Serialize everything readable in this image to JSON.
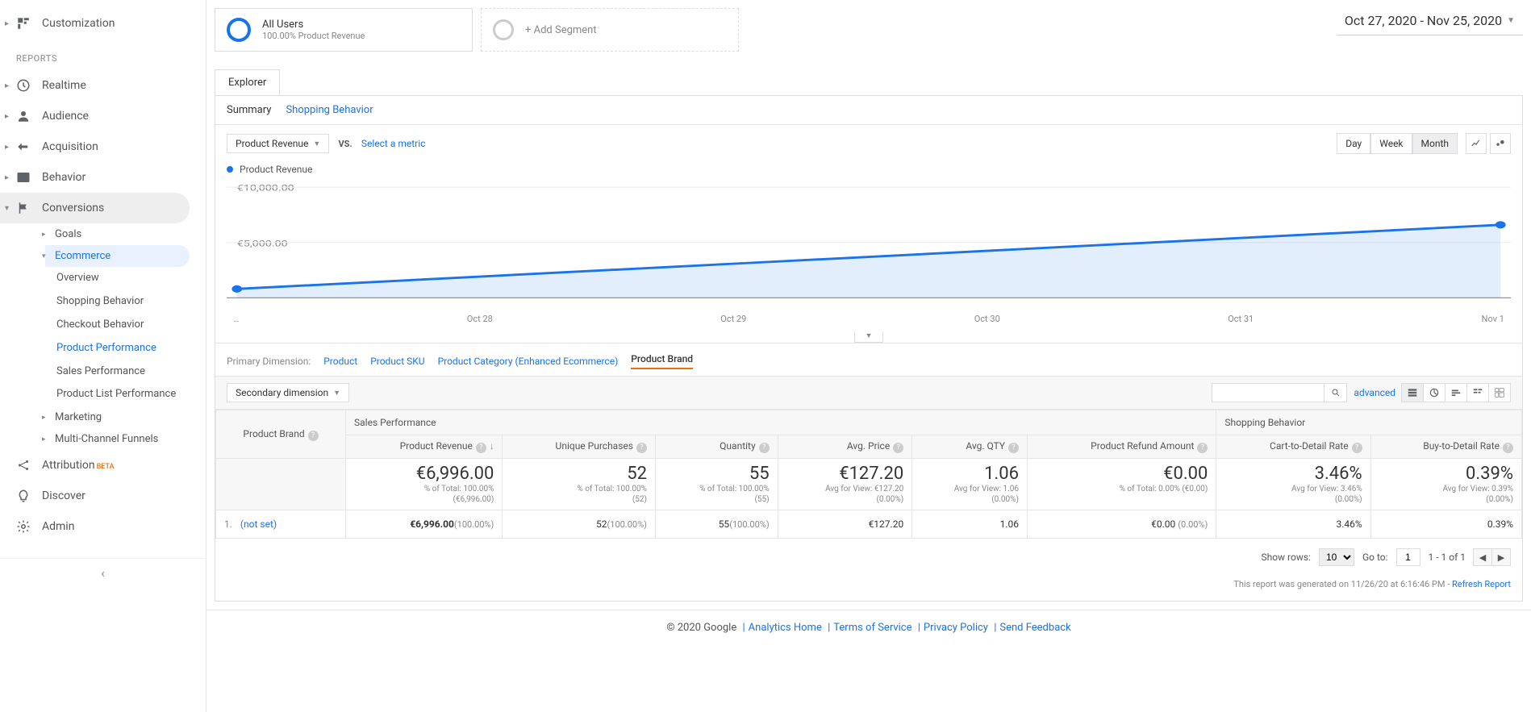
{
  "sidebar": {
    "customization": "Customization",
    "reports_header": "REPORTS",
    "realtime": "Realtime",
    "audience": "Audience",
    "acquisition": "Acquisition",
    "behavior": "Behavior",
    "conversions": "Conversions",
    "goals": "Goals",
    "ecommerce": "Ecommerce",
    "eco_items": {
      "overview": "Overview",
      "shopping": "Shopping Behavior",
      "checkout": "Checkout Behavior",
      "product": "Product Performance",
      "sales": "Sales Performance",
      "plist": "Product List Performance"
    },
    "marketing": "Marketing",
    "multi": "Multi-Channel Funnels",
    "attribution": "Attribution",
    "beta": "BETA",
    "discover": "Discover",
    "admin": "Admin"
  },
  "segments": {
    "all_users": "All Users",
    "all_users_sub": "100.00% Product Revenue",
    "add": "+ Add Segment"
  },
  "daterange": "Oct 27, 2020 - Nov 25, 2020",
  "tabs": {
    "explorer": "Explorer",
    "summary": "Summary",
    "shopping": "Shopping Behavior"
  },
  "metric_selector": "Product Revenue",
  "vs": "VS.",
  "select_metric": "Select a metric",
  "time": {
    "day": "Day",
    "week": "Week",
    "month": "Month"
  },
  "legend": "Product Revenue",
  "chart_data": {
    "type": "line",
    "x": [
      "…",
      "Oct 28",
      "Oct 29",
      "Oct 30",
      "Oct 31",
      "Nov 1"
    ],
    "values": [
      800,
      1960,
      3120,
      4280,
      5440,
      6600
    ],
    "yticks": [
      "€10,000.00",
      "€5,000.00"
    ],
    "ylim": [
      0,
      10000
    ]
  },
  "primary_dim": {
    "label": "Primary Dimension:",
    "product": "Product",
    "sku": "Product SKU",
    "category": "Product Category (Enhanced Ecommerce)",
    "brand": "Product Brand"
  },
  "secondary_dim": "Secondary dimension",
  "advanced": "advanced",
  "table": {
    "group_sales": "Sales Performance",
    "group_shopping": "Shopping Behavior",
    "col_brand": "Product Brand",
    "cols": {
      "rev": "Product Revenue",
      "uniq": "Unique Purchases",
      "qty": "Quantity",
      "avgp": "Avg. Price",
      "avgq": "Avg. QTY",
      "refund": "Product Refund Amount",
      "cart": "Cart-to-Detail Rate",
      "buy": "Buy-to-Detail Rate"
    },
    "totals": {
      "rev": "€6,996.00",
      "rev_sub1": "% of Total: 100.00%",
      "rev_sub2": "(€6,996.00)",
      "uniq": "52",
      "uniq_sub1": "% of Total: 100.00%",
      "uniq_sub2": "(52)",
      "qty": "55",
      "qty_sub1": "% of Total: 100.00%",
      "qty_sub2": "(55)",
      "avgp": "€127.20",
      "avgp_sub1": "Avg for View: €127.20",
      "avgp_sub2": "(0.00%)",
      "avgq": "1.06",
      "avgq_sub1": "Avg for View: 1.06",
      "avgq_sub2": "(0.00%)",
      "refund": "€0.00",
      "refund_sub1": "% of Total: 0.00% (€0.00)",
      "cart": "3.46%",
      "cart_sub1": "Avg for View: 3.46%",
      "cart_sub2": "(0.00%)",
      "buy": "0.39%",
      "buy_sub1": "Avg for View: 0.39%",
      "buy_sub2": "(0.00%)"
    },
    "row": {
      "n": "1.",
      "name": "(not set)",
      "rev": "€6,996.00",
      "rev_p": "(100.00%)",
      "uniq": "52",
      "uniq_p": "(100.00%)",
      "qty": "55",
      "qty_p": "(100.00%)",
      "avgp": "€127.20",
      "avgq": "1.06",
      "refund": "€0.00",
      "refund_p": "(0.00%)",
      "cart": "3.46%",
      "buy": "0.39%"
    }
  },
  "pager": {
    "show_rows": "Show rows:",
    "rows_val": "10",
    "goto": "Go to:",
    "goto_val": "1",
    "range": "1 - 1 of 1"
  },
  "report_meta": "This report was generated on 11/26/20 at 6:16:46 PM - ",
  "refresh": "Refresh Report",
  "footer": {
    "copyright": "© 2020 Google",
    "home": "Analytics Home",
    "tos": "Terms of Service",
    "privacy": "Privacy Policy",
    "feedback": "Send Feedback"
  }
}
